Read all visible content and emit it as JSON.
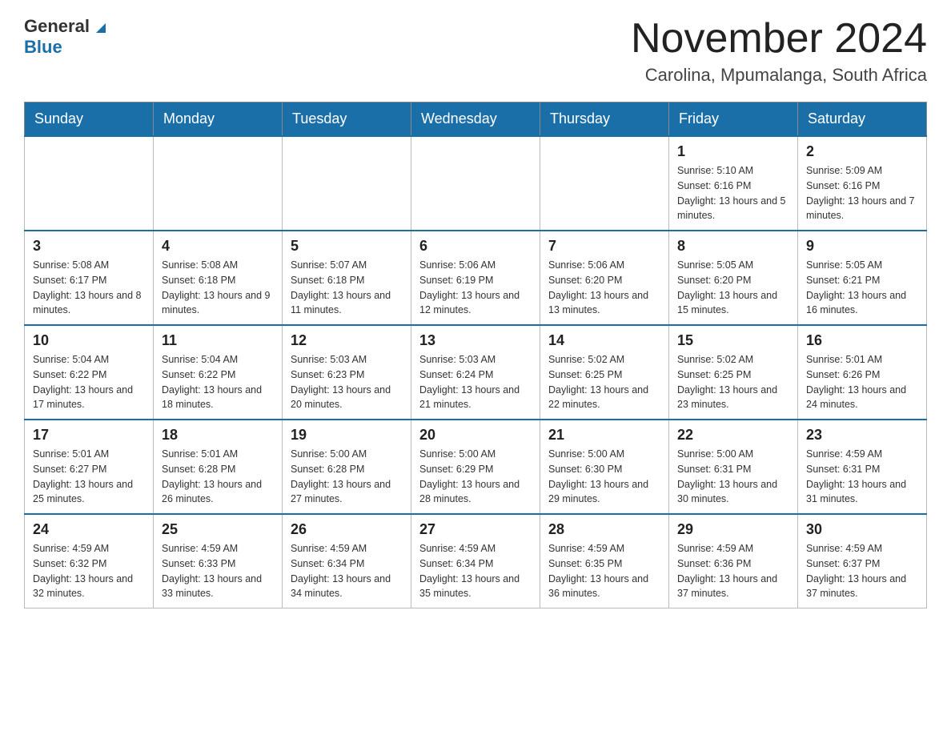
{
  "header": {
    "logo_general": "General",
    "logo_blue": "Blue",
    "month_title": "November 2024",
    "location": "Carolina, Mpumalanga, South Africa"
  },
  "weekdays": [
    "Sunday",
    "Monday",
    "Tuesday",
    "Wednesday",
    "Thursday",
    "Friday",
    "Saturday"
  ],
  "weeks": [
    [
      {
        "day": "",
        "info": ""
      },
      {
        "day": "",
        "info": ""
      },
      {
        "day": "",
        "info": ""
      },
      {
        "day": "",
        "info": ""
      },
      {
        "day": "",
        "info": ""
      },
      {
        "day": "1",
        "info": "Sunrise: 5:10 AM\nSunset: 6:16 PM\nDaylight: 13 hours and 5 minutes."
      },
      {
        "day": "2",
        "info": "Sunrise: 5:09 AM\nSunset: 6:16 PM\nDaylight: 13 hours and 7 minutes."
      }
    ],
    [
      {
        "day": "3",
        "info": "Sunrise: 5:08 AM\nSunset: 6:17 PM\nDaylight: 13 hours and 8 minutes."
      },
      {
        "day": "4",
        "info": "Sunrise: 5:08 AM\nSunset: 6:18 PM\nDaylight: 13 hours and 9 minutes."
      },
      {
        "day": "5",
        "info": "Sunrise: 5:07 AM\nSunset: 6:18 PM\nDaylight: 13 hours and 11 minutes."
      },
      {
        "day": "6",
        "info": "Sunrise: 5:06 AM\nSunset: 6:19 PM\nDaylight: 13 hours and 12 minutes."
      },
      {
        "day": "7",
        "info": "Sunrise: 5:06 AM\nSunset: 6:20 PM\nDaylight: 13 hours and 13 minutes."
      },
      {
        "day": "8",
        "info": "Sunrise: 5:05 AM\nSunset: 6:20 PM\nDaylight: 13 hours and 15 minutes."
      },
      {
        "day": "9",
        "info": "Sunrise: 5:05 AM\nSunset: 6:21 PM\nDaylight: 13 hours and 16 minutes."
      }
    ],
    [
      {
        "day": "10",
        "info": "Sunrise: 5:04 AM\nSunset: 6:22 PM\nDaylight: 13 hours and 17 minutes."
      },
      {
        "day": "11",
        "info": "Sunrise: 5:04 AM\nSunset: 6:22 PM\nDaylight: 13 hours and 18 minutes."
      },
      {
        "day": "12",
        "info": "Sunrise: 5:03 AM\nSunset: 6:23 PM\nDaylight: 13 hours and 20 minutes."
      },
      {
        "day": "13",
        "info": "Sunrise: 5:03 AM\nSunset: 6:24 PM\nDaylight: 13 hours and 21 minutes."
      },
      {
        "day": "14",
        "info": "Sunrise: 5:02 AM\nSunset: 6:25 PM\nDaylight: 13 hours and 22 minutes."
      },
      {
        "day": "15",
        "info": "Sunrise: 5:02 AM\nSunset: 6:25 PM\nDaylight: 13 hours and 23 minutes."
      },
      {
        "day": "16",
        "info": "Sunrise: 5:01 AM\nSunset: 6:26 PM\nDaylight: 13 hours and 24 minutes."
      }
    ],
    [
      {
        "day": "17",
        "info": "Sunrise: 5:01 AM\nSunset: 6:27 PM\nDaylight: 13 hours and 25 minutes."
      },
      {
        "day": "18",
        "info": "Sunrise: 5:01 AM\nSunset: 6:28 PM\nDaylight: 13 hours and 26 minutes."
      },
      {
        "day": "19",
        "info": "Sunrise: 5:00 AM\nSunset: 6:28 PM\nDaylight: 13 hours and 27 minutes."
      },
      {
        "day": "20",
        "info": "Sunrise: 5:00 AM\nSunset: 6:29 PM\nDaylight: 13 hours and 28 minutes."
      },
      {
        "day": "21",
        "info": "Sunrise: 5:00 AM\nSunset: 6:30 PM\nDaylight: 13 hours and 29 minutes."
      },
      {
        "day": "22",
        "info": "Sunrise: 5:00 AM\nSunset: 6:31 PM\nDaylight: 13 hours and 30 minutes."
      },
      {
        "day": "23",
        "info": "Sunrise: 4:59 AM\nSunset: 6:31 PM\nDaylight: 13 hours and 31 minutes."
      }
    ],
    [
      {
        "day": "24",
        "info": "Sunrise: 4:59 AM\nSunset: 6:32 PM\nDaylight: 13 hours and 32 minutes."
      },
      {
        "day": "25",
        "info": "Sunrise: 4:59 AM\nSunset: 6:33 PM\nDaylight: 13 hours and 33 minutes."
      },
      {
        "day": "26",
        "info": "Sunrise: 4:59 AM\nSunset: 6:34 PM\nDaylight: 13 hours and 34 minutes."
      },
      {
        "day": "27",
        "info": "Sunrise: 4:59 AM\nSunset: 6:34 PM\nDaylight: 13 hours and 35 minutes."
      },
      {
        "day": "28",
        "info": "Sunrise: 4:59 AM\nSunset: 6:35 PM\nDaylight: 13 hours and 36 minutes."
      },
      {
        "day": "29",
        "info": "Sunrise: 4:59 AM\nSunset: 6:36 PM\nDaylight: 13 hours and 37 minutes."
      },
      {
        "day": "30",
        "info": "Sunrise: 4:59 AM\nSunset: 6:37 PM\nDaylight: 13 hours and 37 minutes."
      }
    ]
  ]
}
